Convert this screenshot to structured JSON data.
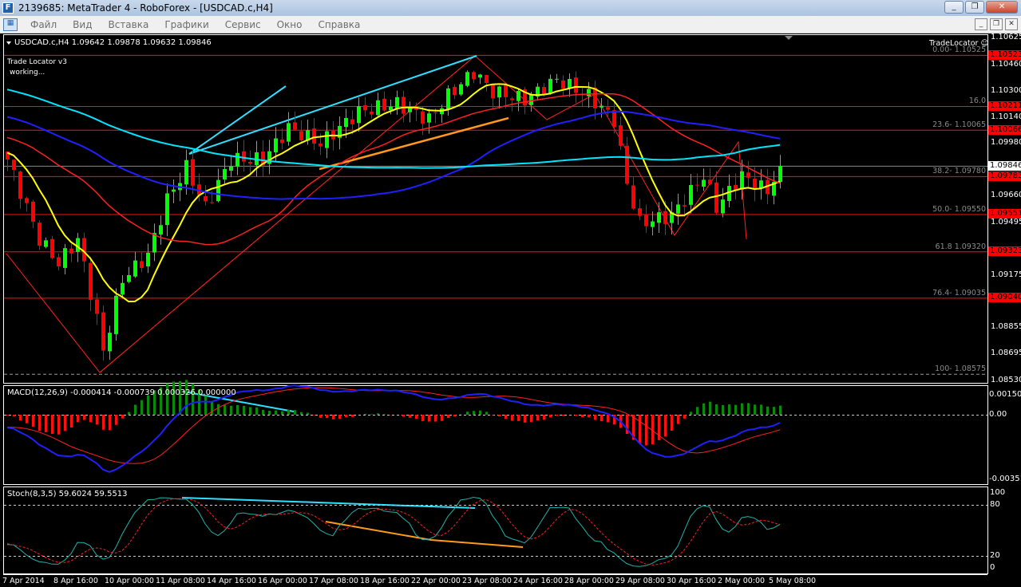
{
  "window": {
    "title": "2139685: MetaTrader 4 - RoboForex - [USDCAD.c,H4]",
    "app_icon": "mt4-icon"
  },
  "menu": [
    "Файл",
    "Вид",
    "Вставка",
    "Графики",
    "Сервис",
    "Окно",
    "Справка"
  ],
  "chart": {
    "header": "USDCAD.c,H4  1.09642 1.09878 1.09632 1.09846",
    "indicator_note_1": "Trade Locator v3",
    "indicator_note_2": "working...",
    "tradelocator_label": "TradeLocator ☺",
    "price_axis": [
      "1.10625",
      "1.10460",
      "1.10300",
      "1.10140",
      "1.09980",
      "1.09660",
      "1.09495",
      "1.09175",
      "1.08855",
      "1.08695",
      "1.08530"
    ],
    "price_tags": [
      "1.10523",
      "1.10211",
      "1.10066",
      "1.09783",
      "1.09551",
      "1.09323",
      "1.09040"
    ],
    "current_price": "1.09846",
    "fib_labels": [
      "0.00- 1.10525",
      "16.0",
      "23.6- 1.10065",
      "38.2- 1.09780",
      "50.0- 1.09550",
      "61.8 1.09320",
      "76.4- 1.09035",
      "100- 1.08575"
    ],
    "macd": {
      "label": "MACD(12,26,9) -0.000414 -0.000739 0.000326 0.000000",
      "axis": [
        "0.001505",
        "0.00",
        "-0.003511"
      ]
    },
    "stoch": {
      "label": "Stoch(8,3,5) 59.6024 59.5513",
      "axis": [
        "100",
        "80",
        "20",
        "0"
      ]
    },
    "time_axis": [
      "7 Apr 2014",
      "8 Apr 16:00",
      "10 Apr 00:00",
      "11 Apr 08:00",
      "14 Apr 16:00",
      "16 Apr 00:00",
      "17 Apr 08:00",
      "18 Apr 16:00",
      "22 Apr 00:00",
      "23 Apr 08:00",
      "24 Apr 16:00",
      "28 Apr 00:00",
      "29 Apr 08:00",
      "30 Apr 16:00",
      "2 May 00:00",
      "5 May 08:00"
    ]
  },
  "chart_data": {
    "type": "candlestick",
    "symbol": "USDCAD.c",
    "timeframe": "H4",
    "ylim": [
      1.0853,
      1.10625
    ],
    "key_closes": [
      [
        0,
        1.09884
      ],
      [
        2,
        1.0969
      ],
      [
        5,
        1.09397
      ],
      [
        8,
        1.09251
      ],
      [
        11,
        1.09397
      ],
      [
        14,
        1.0891
      ],
      [
        15,
        1.08715
      ],
      [
        18,
        1.09154
      ],
      [
        22,
        1.093
      ],
      [
        25,
        1.09641
      ],
      [
        28,
        1.09836
      ],
      [
        31,
        1.09592
      ],
      [
        35,
        1.09884
      ],
      [
        40,
        1.09884
      ],
      [
        44,
        1.10079
      ],
      [
        49,
        1.09982
      ],
      [
        55,
        1.10177
      ],
      [
        61,
        1.10226
      ],
      [
        66,
        1.10128
      ],
      [
        69,
        1.10274
      ],
      [
        73,
        1.1042
      ],
      [
        76,
        1.10299
      ],
      [
        81,
        1.1025
      ],
      [
        86,
        1.10372
      ],
      [
        91,
        1.10274
      ],
      [
        95,
        1.10128
      ],
      [
        97,
        1.09738
      ],
      [
        99,
        1.09495
      ],
      [
        104,
        1.09543
      ],
      [
        109,
        1.09787
      ],
      [
        111,
        1.09592
      ],
      [
        115,
        1.09787
      ],
      [
        119,
        1.0969
      ],
      [
        121,
        1.09846
      ]
    ],
    "fib_levels": [
      1.10523,
      1.10211,
      1.10066,
      1.09783,
      1.09551,
      1.09323,
      1.0904,
      1.08575
    ],
    "colors": {
      "bull": "#00ff00",
      "bear": "#ff0000",
      "ma_fast": "#ffff00",
      "ma_mid": "#ff2020",
      "ma_slow": "#2020ff",
      "ma_long": "#00e5ff"
    }
  }
}
